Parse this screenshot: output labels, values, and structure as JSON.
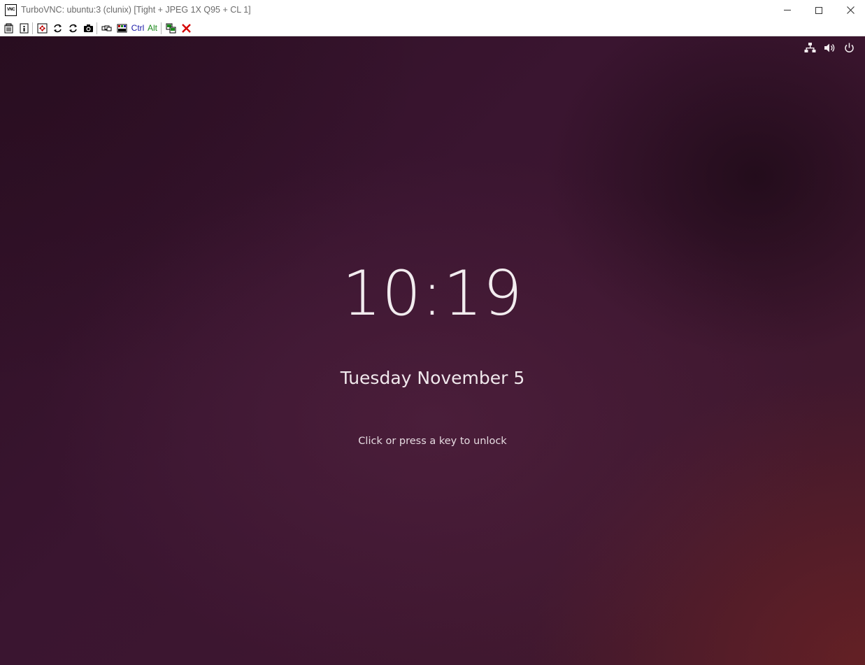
{
  "window": {
    "title": "TurboVNC: ubuntu:3 (clunix) [Tight + JPEG 1X Q95 + CL 1]",
    "app_icon_label": "VNC"
  },
  "toolbar": {
    "ctrl_label": "Ctrl",
    "alt_label": "Alt",
    "ctrl_color": "#1a1aa8",
    "alt_color": "#1d8a1d"
  },
  "lock_screen": {
    "time": "10:19",
    "date": "Tuesday November 5",
    "hint": "Click or press a key to unlock"
  },
  "colors": {
    "background": "#3a1530",
    "text": "#f2ecef"
  }
}
